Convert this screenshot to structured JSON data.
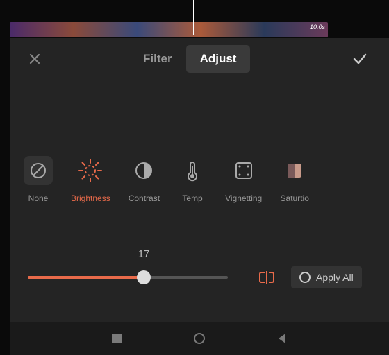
{
  "timeline": {
    "duration_label": "10.0s"
  },
  "tabs": {
    "filter": "Filter",
    "adjust": "Adjust"
  },
  "options": {
    "none": "None",
    "brightness": "Brightness",
    "contrast": "Contrast",
    "temp": "Temp",
    "vignetting": "Vignetting",
    "saturation": "Saturtio"
  },
  "slider": {
    "value": 17,
    "min": -50,
    "max": 50,
    "percent": 58
  },
  "apply_all": "Apply All"
}
